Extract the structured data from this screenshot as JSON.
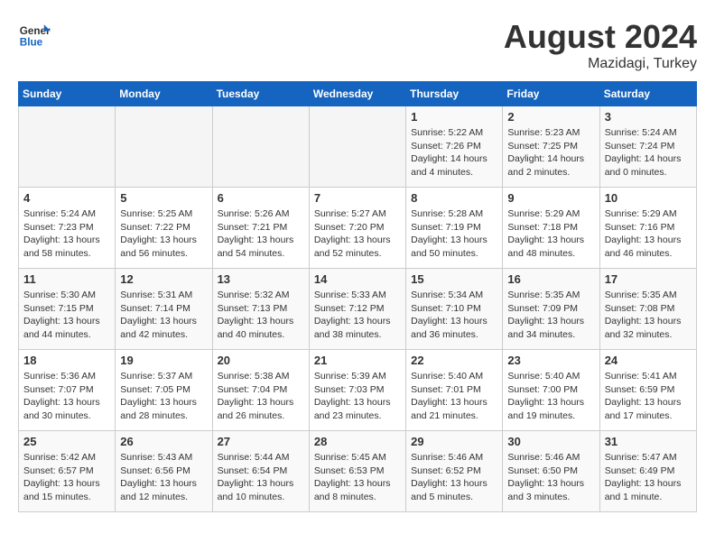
{
  "header": {
    "logo_general": "General",
    "logo_blue": "Blue",
    "month_title": "August 2024",
    "location": "Mazidagi, Turkey"
  },
  "weekdays": [
    "Sunday",
    "Monday",
    "Tuesday",
    "Wednesday",
    "Thursday",
    "Friday",
    "Saturday"
  ],
  "weeks": [
    [
      {
        "day": "",
        "info": ""
      },
      {
        "day": "",
        "info": ""
      },
      {
        "day": "",
        "info": ""
      },
      {
        "day": "",
        "info": ""
      },
      {
        "day": "1",
        "info": "Sunrise: 5:22 AM\nSunset: 7:26 PM\nDaylight: 14 hours\nand 4 minutes."
      },
      {
        "day": "2",
        "info": "Sunrise: 5:23 AM\nSunset: 7:25 PM\nDaylight: 14 hours\nand 2 minutes."
      },
      {
        "day": "3",
        "info": "Sunrise: 5:24 AM\nSunset: 7:24 PM\nDaylight: 14 hours\nand 0 minutes."
      }
    ],
    [
      {
        "day": "4",
        "info": "Sunrise: 5:24 AM\nSunset: 7:23 PM\nDaylight: 13 hours\nand 58 minutes."
      },
      {
        "day": "5",
        "info": "Sunrise: 5:25 AM\nSunset: 7:22 PM\nDaylight: 13 hours\nand 56 minutes."
      },
      {
        "day": "6",
        "info": "Sunrise: 5:26 AM\nSunset: 7:21 PM\nDaylight: 13 hours\nand 54 minutes."
      },
      {
        "day": "7",
        "info": "Sunrise: 5:27 AM\nSunset: 7:20 PM\nDaylight: 13 hours\nand 52 minutes."
      },
      {
        "day": "8",
        "info": "Sunrise: 5:28 AM\nSunset: 7:19 PM\nDaylight: 13 hours\nand 50 minutes."
      },
      {
        "day": "9",
        "info": "Sunrise: 5:29 AM\nSunset: 7:18 PM\nDaylight: 13 hours\nand 48 minutes."
      },
      {
        "day": "10",
        "info": "Sunrise: 5:29 AM\nSunset: 7:16 PM\nDaylight: 13 hours\nand 46 minutes."
      }
    ],
    [
      {
        "day": "11",
        "info": "Sunrise: 5:30 AM\nSunset: 7:15 PM\nDaylight: 13 hours\nand 44 minutes."
      },
      {
        "day": "12",
        "info": "Sunrise: 5:31 AM\nSunset: 7:14 PM\nDaylight: 13 hours\nand 42 minutes."
      },
      {
        "day": "13",
        "info": "Sunrise: 5:32 AM\nSunset: 7:13 PM\nDaylight: 13 hours\nand 40 minutes."
      },
      {
        "day": "14",
        "info": "Sunrise: 5:33 AM\nSunset: 7:12 PM\nDaylight: 13 hours\nand 38 minutes."
      },
      {
        "day": "15",
        "info": "Sunrise: 5:34 AM\nSunset: 7:10 PM\nDaylight: 13 hours\nand 36 minutes."
      },
      {
        "day": "16",
        "info": "Sunrise: 5:35 AM\nSunset: 7:09 PM\nDaylight: 13 hours\nand 34 minutes."
      },
      {
        "day": "17",
        "info": "Sunrise: 5:35 AM\nSunset: 7:08 PM\nDaylight: 13 hours\nand 32 minutes."
      }
    ],
    [
      {
        "day": "18",
        "info": "Sunrise: 5:36 AM\nSunset: 7:07 PM\nDaylight: 13 hours\nand 30 minutes."
      },
      {
        "day": "19",
        "info": "Sunrise: 5:37 AM\nSunset: 7:05 PM\nDaylight: 13 hours\nand 28 minutes."
      },
      {
        "day": "20",
        "info": "Sunrise: 5:38 AM\nSunset: 7:04 PM\nDaylight: 13 hours\nand 26 minutes."
      },
      {
        "day": "21",
        "info": "Sunrise: 5:39 AM\nSunset: 7:03 PM\nDaylight: 13 hours\nand 23 minutes."
      },
      {
        "day": "22",
        "info": "Sunrise: 5:40 AM\nSunset: 7:01 PM\nDaylight: 13 hours\nand 21 minutes."
      },
      {
        "day": "23",
        "info": "Sunrise: 5:40 AM\nSunset: 7:00 PM\nDaylight: 13 hours\nand 19 minutes."
      },
      {
        "day": "24",
        "info": "Sunrise: 5:41 AM\nSunset: 6:59 PM\nDaylight: 13 hours\nand 17 minutes."
      }
    ],
    [
      {
        "day": "25",
        "info": "Sunrise: 5:42 AM\nSunset: 6:57 PM\nDaylight: 13 hours\nand 15 minutes."
      },
      {
        "day": "26",
        "info": "Sunrise: 5:43 AM\nSunset: 6:56 PM\nDaylight: 13 hours\nand 12 minutes."
      },
      {
        "day": "27",
        "info": "Sunrise: 5:44 AM\nSunset: 6:54 PM\nDaylight: 13 hours\nand 10 minutes."
      },
      {
        "day": "28",
        "info": "Sunrise: 5:45 AM\nSunset: 6:53 PM\nDaylight: 13 hours\nand 8 minutes."
      },
      {
        "day": "29",
        "info": "Sunrise: 5:46 AM\nSunset: 6:52 PM\nDaylight: 13 hours\nand 5 minutes."
      },
      {
        "day": "30",
        "info": "Sunrise: 5:46 AM\nSunset: 6:50 PM\nDaylight: 13 hours\nand 3 minutes."
      },
      {
        "day": "31",
        "info": "Sunrise: 5:47 AM\nSunset: 6:49 PM\nDaylight: 13 hours\nand 1 minute."
      }
    ]
  ]
}
